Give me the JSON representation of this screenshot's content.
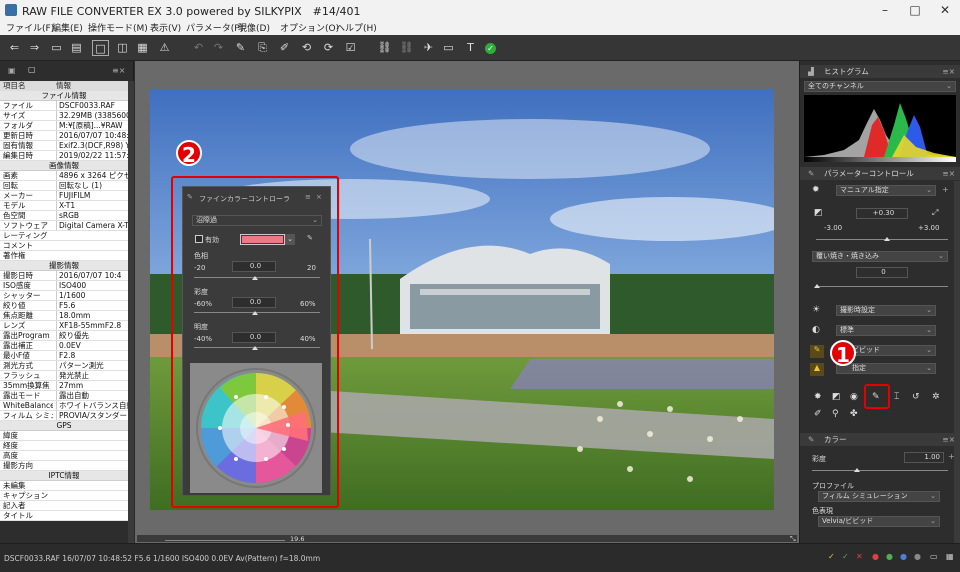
{
  "window": {
    "title": "RAW FILE CONVERTER EX 3.0 powered by SILKYPIX　#14/401"
  },
  "menu": [
    "ファイル(F)",
    "編集(E)",
    "操作モード(M)",
    "表示(V)",
    "パラメータ(P)",
    "現像(D)",
    "オプション(O)",
    "ヘルプ(H)"
  ],
  "left_panel": {
    "col_item": "項目名",
    "col_info": "情報",
    "sections": [
      {
        "title": "ファイル情報",
        "rows": [
          [
            "ファイル",
            "DSCF0033.RAF"
          ],
          [
            "サイズ",
            "32.29MB (3385600"
          ],
          [
            "フォルダ",
            "M:¥[原稿]...¥RAW"
          ],
          [
            "更新日時",
            "2016/07/07 10:48:"
          ],
          [
            "固有情報",
            "Exif2.3(DCF,R98) Y"
          ],
          [
            "編集日時",
            "2019/02/22 11:57:"
          ]
        ]
      },
      {
        "title": "画像情報",
        "rows": [
          [
            "画素",
            "4896 x 3264 ピクセ"
          ],
          [
            "回転",
            "回転なし (1)"
          ],
          [
            "メーカー",
            "FUJIFILM"
          ],
          [
            "モデル",
            "X-T1"
          ],
          [
            "色空間",
            "sRGB"
          ],
          [
            "ソフトウェア",
            "Digital Camera X-T"
          ],
          [
            "レーティング",
            ""
          ],
          [
            "コメント",
            ""
          ],
          [
            "著作権",
            ""
          ]
        ]
      },
      {
        "title": "撮影情報",
        "rows": [
          [
            "撮影日時",
            "2016/07/07 10:4"
          ],
          [
            "ISO感度",
            "ISO400"
          ],
          [
            "シャッター",
            "1/1600"
          ],
          [
            "絞り値",
            "F5.6"
          ],
          [
            "焦点距離",
            "18.0mm"
          ],
          [
            "レンズ",
            "XF18-55mmF2.8"
          ],
          [
            "露出Program",
            "絞り優先"
          ],
          [
            "露出補正",
            "0.0EV"
          ],
          [
            "最小F値",
            "F2.8"
          ],
          [
            "測光方式",
            "パターン測光"
          ],
          [
            "フラッシュ",
            "発光禁止"
          ],
          [
            "35mm換算焦",
            "27mm"
          ],
          [
            "露出モード",
            "露出自動"
          ],
          [
            "WhiteBalance",
            "ホワイトバランス自動"
          ],
          [
            "フィルム シミュレー",
            "PROVIA/スタンダード"
          ]
        ]
      },
      {
        "title": "GPS",
        "rows": [
          [
            "緯度",
            ""
          ],
          [
            "経度",
            ""
          ],
          [
            "高度",
            ""
          ],
          [
            "撮影方向",
            ""
          ]
        ]
      },
      {
        "title": "IPTC情報",
        "rows": [
          [
            "未編集",
            ""
          ],
          [
            "キャプション",
            ""
          ],
          [
            "記入者",
            ""
          ],
          [
            "タイトル",
            ""
          ]
        ]
      }
    ]
  },
  "viewer": {
    "zoom": "19.6"
  },
  "status": {
    "text": "DSCF0033.RAF 16/07/07 10:48:52 F5.6 1/1600 ISO400  0.0EV Av(Pattern) f=18.0mm"
  },
  "right_panel": {
    "histogram": {
      "title": "ヒストグラム",
      "channel": "全てのチャンネル"
    },
    "params": {
      "title": "パラメーターコントロール",
      "exposure_mode": "マニュアル指定",
      "exposure_value": "+0.30",
      "exposure_min": "-3.00",
      "exposure_max": "+3.00",
      "dodge": "覆い焼き・焼き込み",
      "dodge_value": "0",
      "scene": "撮影時設定",
      "tone": "標準",
      "color_style": "ビビッド",
      "color_style2": "指定"
    },
    "color": {
      "title": "カラー",
      "saturation_label": "彩度",
      "saturation_value": "1.00",
      "profile_label": "プロファイル",
      "profile_value": "フィルム シミュレーション",
      "expression_label": "色表現",
      "expression_value": "Velvia/ビビッド"
    }
  },
  "fine_color": {
    "title": "ファインカラーコントローラ",
    "target": "沼際過",
    "enable_label": "有効",
    "swatch": "#ea7b86",
    "hue_label": "色相",
    "hue_min": "-20",
    "hue_value": "0.0",
    "hue_max": "20",
    "sat_label": "彩度",
    "sat_min": "-60%",
    "sat_value": "0.0",
    "sat_max": "60%",
    "lum_label": "明度",
    "lum_min": "-40%",
    "lum_value": "0.0",
    "lum_max": "40%"
  },
  "annotations": {
    "one": "1",
    "two": "2"
  },
  "colors": {
    "highlight": "#e20000"
  }
}
